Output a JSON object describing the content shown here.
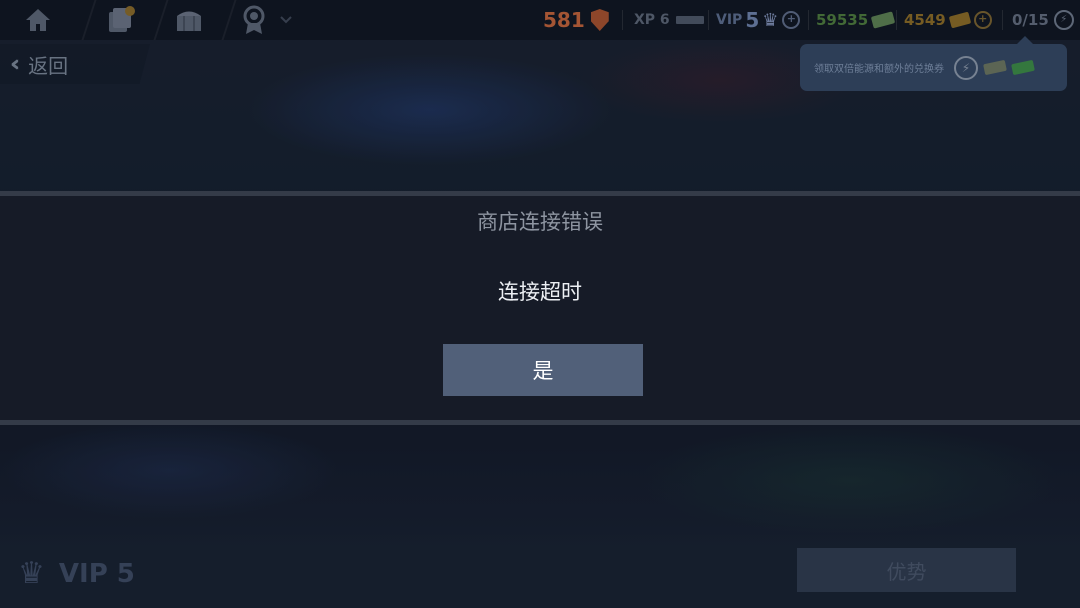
{
  "topbar": {
    "rank_value": "581",
    "xp_label": "XP 6",
    "vip_label": "VIP",
    "vip_level": "5",
    "cash": "59535",
    "gold": "4549",
    "energy": "0/15"
  },
  "back": {
    "label": "返回"
  },
  "tooltip": {
    "text": "领取双倍能源和额外的兑换券"
  },
  "dialog": {
    "title": "商店连接错误",
    "message": "连接超时",
    "confirm_label": "是"
  },
  "bottom": {
    "vip_label": "VIP 5",
    "advantage_label": "优势"
  },
  "colors": {
    "accent_button": "#516079",
    "dialog_bg": "#161b27",
    "cash_green": "#4d7a3d",
    "gold_yellow": "#8a6a26"
  }
}
